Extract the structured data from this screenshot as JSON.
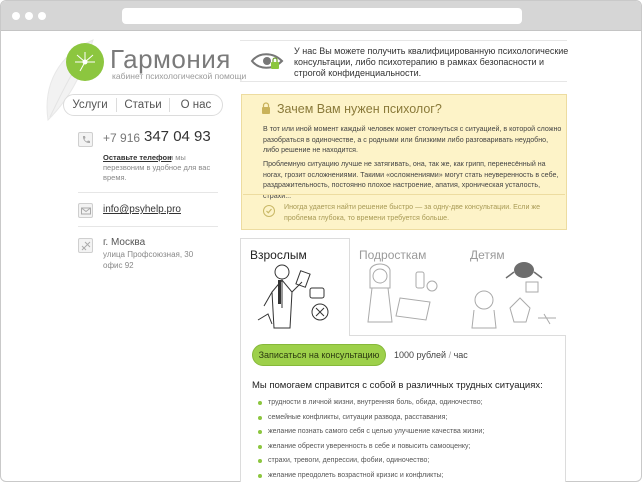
{
  "brand": {
    "title": "Гармония",
    "subtitle": "кабинет психологической помощи",
    "accent_color": "#8cc63f"
  },
  "nav": {
    "items": [
      {
        "label": "Услуги"
      },
      {
        "label": "Статьи"
      },
      {
        "label": "О нас"
      }
    ]
  },
  "contacts": {
    "phone_prefix": "+7 916",
    "phone_number": "347 04 93",
    "leave_phone_link": "Оставьте телефон",
    "leave_phone_note": "и мы перезвоним в удобное для вас время.",
    "email": "info@psyhelp.pro",
    "city": "г. Москва",
    "street": "улица Профсоюзная, 30",
    "office": "офис 92",
    "icons": [
      "phone-icon",
      "mail-icon",
      "map-pin-icon"
    ]
  },
  "intro": {
    "text": "У нас Вы можете получить квалифицированную психологические консультации, либо психотерапию в рамках безопасности и строгой конфиденциальности."
  },
  "why": {
    "title": "Зачем Вам нужен психолог?",
    "paragraph1": "В тот или иной момент каждый человек может столкнуться с ситуацией, в которой сложно разобраться в одиночестве, а с родными или близкими либо разговаривать неудобно, либо решение не находится.",
    "paragraph2": "Проблемную ситуацию лучше не затягивать, она, так же, как грипп, перенесённый на ногах, грозит осложнениями. Такими «осложнениями» могут стать неуверенность в себе, раздражительность, постоянно плохое настроение, апатия, хроническая усталость, страхи...",
    "note": "Иногда удается найти решение быстро — за одну-две консультации. Если же проблема глубока, то времени требуется больше."
  },
  "tabs": [
    {
      "label": "Взрослым",
      "active": true
    },
    {
      "label": "Подросткам",
      "active": false
    },
    {
      "label": "Детям",
      "active": false
    }
  ],
  "booking": {
    "button_label": "Записаться на консультацию",
    "price": "1000 рублей",
    "price_unit": "час"
  },
  "help": {
    "title": "Мы помогаем справится с собой в различных трудных ситуациях:",
    "items": [
      "трудности в личной жизни, внутренняя боль, обида, одиночество;",
      "семейные конфликты, ситуации развода, расставания;",
      "желание познать самого себя с целью улучшение качества жизни;",
      "желание обрести уверенность в себе и повысить самооценку;",
      "страхи, тревоги, депрессии, фобии, одиночество;",
      "желание преодолеть возрастной кризис и конфликты;"
    ]
  }
}
